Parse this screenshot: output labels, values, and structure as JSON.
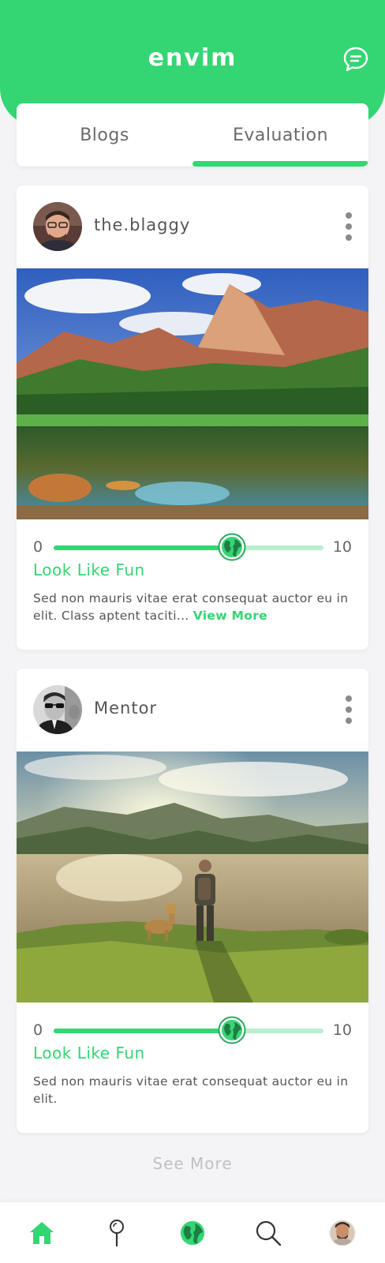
{
  "app": {
    "title": "envim"
  },
  "header": {
    "chat_icon": "chat-bubble-icon"
  },
  "tabs": [
    {
      "label": "Blogs",
      "active": false
    },
    {
      "label": "Evaluation",
      "active": true
    }
  ],
  "posts": [
    {
      "username": "the.blaggy",
      "rating": {
        "min": "0",
        "max": "10",
        "value": 6.6
      },
      "title": "Look Like Fun",
      "text": "Sed non  mauris vitae erat consequat auctor eu in elit. Class aptent taciti...",
      "view_more": "View More"
    },
    {
      "username": "Mentor",
      "rating": {
        "min": "0",
        "max": "10",
        "value": 6.6
      },
      "title": "Look Like Fun",
      "text": "Sed non  mauris vitae erat consequat auctor eu in elit."
    }
  ],
  "footer": {
    "see_more": "See More"
  },
  "nav": [
    "home-icon",
    "map-pin-icon",
    "globe-icon",
    "search-icon",
    "profile-avatar"
  ],
  "colors": {
    "accent": "#34d673",
    "track_light": "#b9efcf"
  }
}
